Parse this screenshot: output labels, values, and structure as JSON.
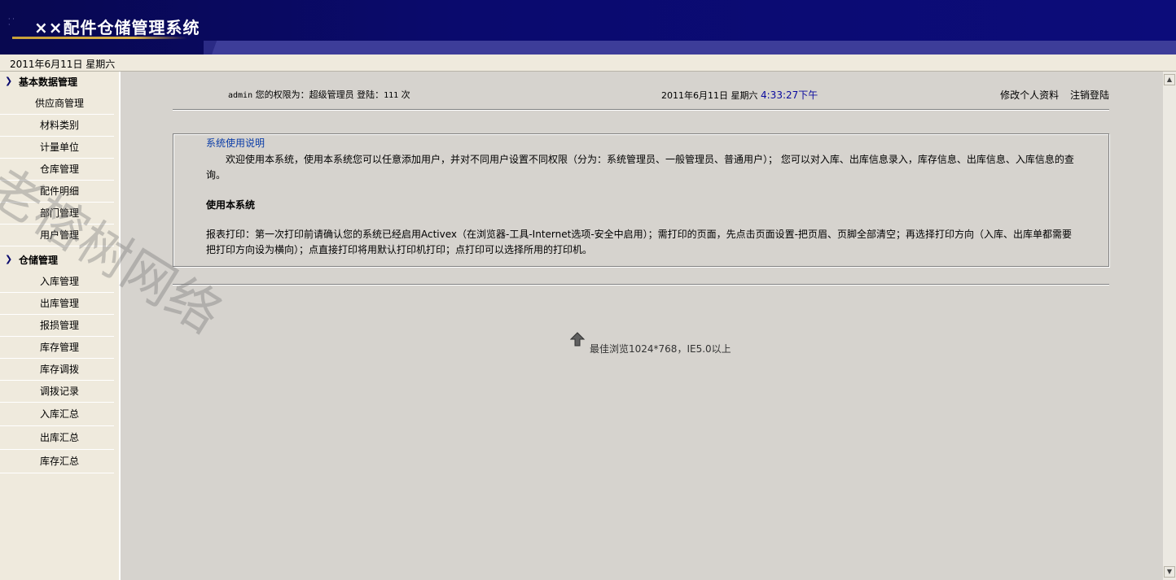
{
  "header": {
    "title": "××配件仓储管理系统"
  },
  "datebar": {
    "date": "2011年6月11日 星期六"
  },
  "sidebar": {
    "sections": [
      {
        "label": "基本数据管理",
        "items": [
          "供应商管理",
          "材料类别",
          "计量单位",
          "仓库管理",
          "配件明细",
          "部门管理",
          "用户管理"
        ]
      },
      {
        "label": "仓储管理",
        "items": [
          "入库管理",
          "出库管理",
          "报损管理",
          "库存管理",
          "库存调拨",
          "调拨记录",
          "入库汇总",
          "出库汇总",
          "库存汇总"
        ]
      }
    ]
  },
  "userbar": {
    "username": "admin",
    "role_prefix": "您的权限为：",
    "role": "超级管理员",
    "login_prefix": "登陆：",
    "login_count": "111",
    "login_suffix": "次",
    "date": "2011年6月11日 星期六",
    "time": "4:33:27下午",
    "edit_profile": "修改个人资料",
    "logout": "注销登陆"
  },
  "info": {
    "title": "系统使用说明",
    "para1": "欢迎使用本系统，使用本系统您可以任意添加用户，并对不同用户设置不同权限（分为：系统管理员、一般管理员、普通用户）；  您可以对入库、出库信息录入，库存信息、出库信息、入库信息的查询。",
    "subtitle": "使用本系统",
    "para2": "报表打印：第一次打印前请确认您的系统已经启用Activex（在浏览器-工具-Internet选项-安全中启用）；需打印的页面，先点击页面设置-把页眉、页脚全部清空；再选择打印方向（入库、出库单都需要把打印方向设为横向）；点直接打印将用默认打印机打印；点打印可以选择所用的打印机。"
  },
  "hint": {
    "text": "最佳浏览1024*768，IE5.0以上"
  },
  "watermark": {
    "text": "老榕树网络"
  },
  "icons": {
    "section": "chevron-right-icon",
    "hint": "up-arrow-icon"
  },
  "colors": {
    "banner": "#0a0a6e",
    "background": "#d6d3ce",
    "sidebar": "#efeadd",
    "link": "#0a3ca8"
  }
}
